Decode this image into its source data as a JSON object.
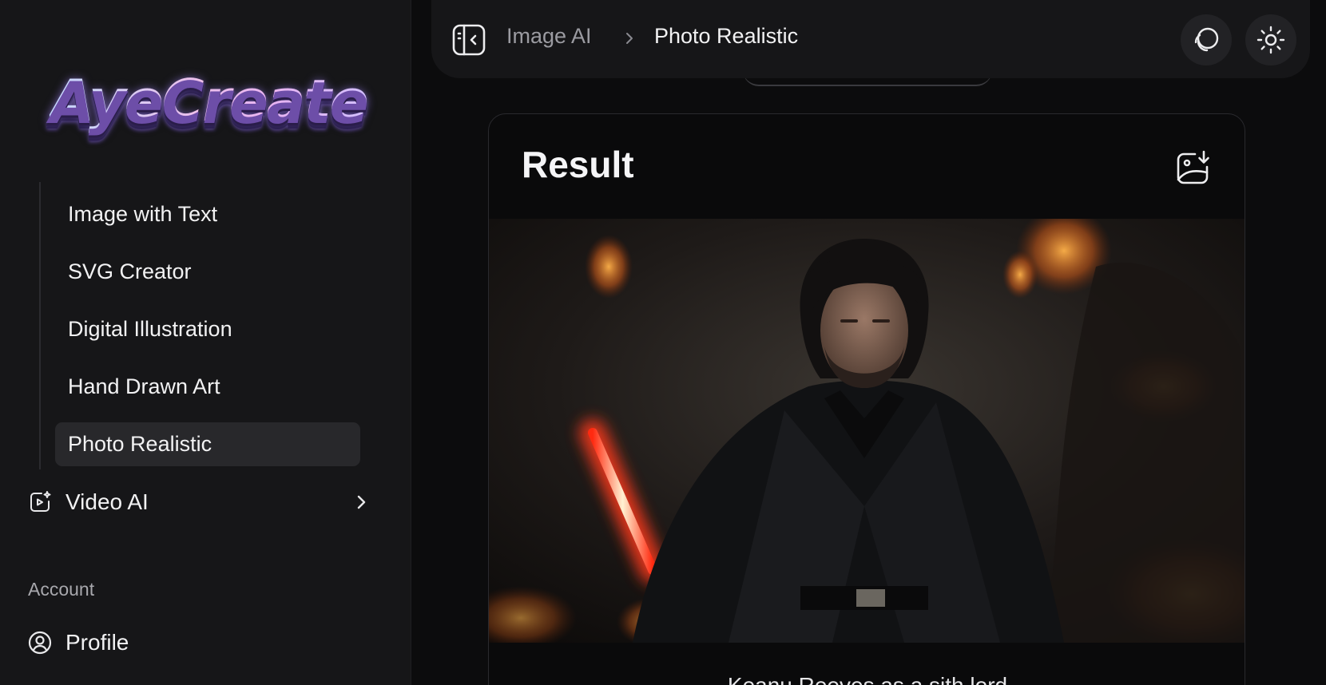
{
  "app": {
    "logo_text": "AyeCreate"
  },
  "sidebar": {
    "subnav": [
      {
        "label": "Image with Text",
        "active": false
      },
      {
        "label": "SVG Creator",
        "active": false
      },
      {
        "label": "Digital Illustration",
        "active": false
      },
      {
        "label": "Hand Drawn Art",
        "active": false
      },
      {
        "label": "Photo Realistic",
        "active": true
      }
    ],
    "video": {
      "label": "Video AI",
      "icon": "video-sparkle-icon"
    },
    "account_section": "Account",
    "profile": {
      "label": "Profile",
      "icon": "user-circle-icon"
    }
  },
  "topbar": {
    "breadcrumb_parent": "Image AI",
    "breadcrumb_current": "Photo Realistic",
    "icons": [
      "sidebar-toggle-icon",
      "chevron-right-icon",
      "loop-icon",
      "sun-icon"
    ]
  },
  "result": {
    "title": "Result",
    "download_icon": "image-download-icon",
    "caption": "Keanu Reeves as a sith lord"
  },
  "colors": {
    "background": "#0c0c0d",
    "sidebar": "#161618",
    "active_item": "#28282b",
    "muted_text": "#9b9ba1",
    "saber": "#ff3a1e"
  }
}
